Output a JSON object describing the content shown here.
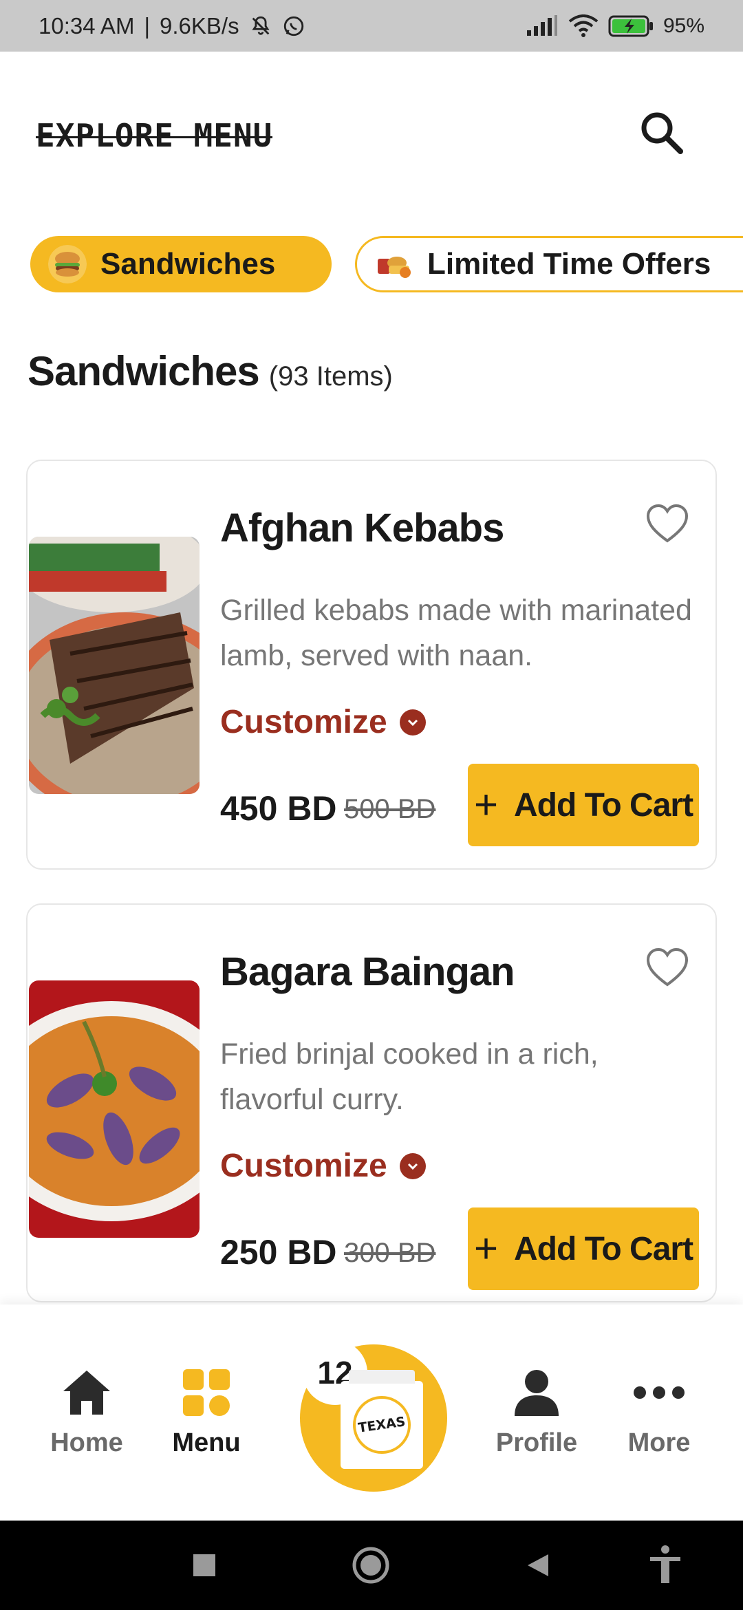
{
  "status_bar": {
    "time": "10:34 AM",
    "separator": "|",
    "speed": "9.6KB/s",
    "battery": "95%",
    "icons": [
      "bell-muted-icon",
      "whatsapp-icon",
      "signal-icon",
      "wifi-icon",
      "battery-charging-icon"
    ]
  },
  "header": {
    "title": "EXPLORE MENU",
    "search_icon": "search-icon"
  },
  "categories": [
    {
      "label": "Sandwiches",
      "selected": true
    },
    {
      "label": "Limited Time Offers",
      "selected": false
    }
  ],
  "section": {
    "title": "Sandwiches",
    "count": "(93 Items)"
  },
  "products": [
    {
      "name": "Afghan Kebabs",
      "description": "Grilled kebabs made with marinated lamb, served with naan.",
      "customize_label": "Customize",
      "price": "450 BD",
      "old_price": "500 BD",
      "add_label": "Add To Cart"
    },
    {
      "name": "Bagara Baingan",
      "description": "Fried brinjal cooked in a rich, flavorful curry.",
      "customize_label": "Customize",
      "price": "250 BD",
      "old_price": "300 BD",
      "add_label": "Add To Cart"
    }
  ],
  "bottom_nav": {
    "items": [
      {
        "label": "Home",
        "icon": "home-icon"
      },
      {
        "label": "Menu",
        "icon": "menu-grid-icon",
        "active": true
      },
      {
        "label": "Profile",
        "icon": "profile-icon"
      },
      {
        "label": "More",
        "icon": "more-dots-icon"
      }
    ],
    "cart_count": "12",
    "cart_logo": "TEXAS"
  },
  "colors": {
    "accent": "#f5b921",
    "customize": "#9a2e1f",
    "status_bar": "#c9c9c9"
  }
}
